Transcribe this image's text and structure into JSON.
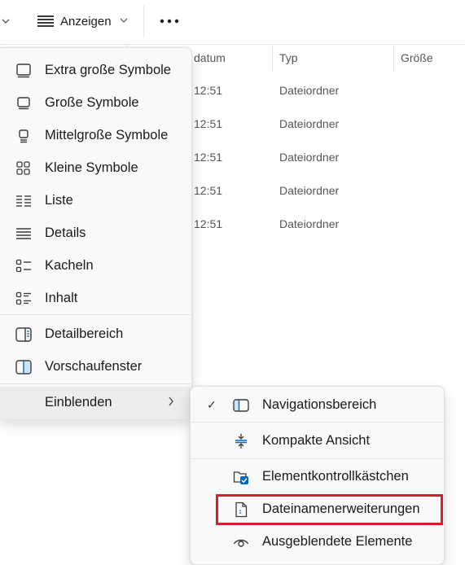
{
  "toolbar": {
    "view_label": "Anzeigen",
    "more_label": "•••"
  },
  "columns": {
    "date_label": "datum",
    "type_label": "Typ",
    "size_label": "Größe"
  },
  "files": [
    {
      "time": "12:51",
      "type": "Dateiordner"
    },
    {
      "time": "12:51",
      "type": "Dateiordner"
    },
    {
      "time": "12:51",
      "type": "Dateiordner"
    },
    {
      "time": "12:51",
      "type": "Dateiordner"
    },
    {
      "time": "12:51",
      "type": "Dateiordner"
    }
  ],
  "menu": {
    "items": [
      {
        "label": "Extra große Symbole",
        "icon": "monitor-large-icon"
      },
      {
        "label": "Große Symbole",
        "icon": "monitor-icon"
      },
      {
        "label": "Mittelgroße Symbole",
        "icon": "monitor-small-icon"
      },
      {
        "label": "Kleine Symbole",
        "icon": "grid-icon"
      },
      {
        "label": "Liste",
        "icon": "list-icon"
      },
      {
        "label": "Details",
        "icon": "details-icon"
      },
      {
        "label": "Kacheln",
        "icon": "tiles-icon"
      },
      {
        "label": "Inhalt",
        "icon": "content-icon"
      },
      {
        "label": "Detailbereich",
        "icon": "details-pane-icon"
      },
      {
        "label": "Vorschaufenster",
        "icon": "preview-pane-icon"
      },
      {
        "label": "Einblenden",
        "icon": "",
        "submenu_arrow": "›"
      }
    ]
  },
  "submenu": {
    "items": [
      {
        "label": "Navigationsbereich",
        "checked": "✓",
        "icon": "navigation-pane-icon"
      },
      {
        "label": "Kompakte Ansicht",
        "icon": "compact-view-icon"
      },
      {
        "label": "Elementkontrollkästchen",
        "icon": "checkbox-folder-icon"
      },
      {
        "label": "Dateinamenerweiterungen",
        "icon": "file-extension-icon"
      },
      {
        "label": "Ausgeblendete Elemente",
        "icon": "hidden-items-eye-icon"
      }
    ]
  },
  "colors": {
    "highlight_box": "#d81e2a",
    "accent_blue": "#0067c0"
  }
}
